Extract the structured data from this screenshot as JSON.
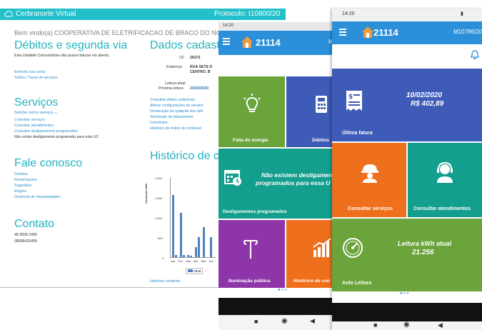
{
  "desktop": {
    "brand": "Cerbranorte Virtual",
    "protocol": "Protocolo: I10800/20",
    "protocol_tag": "(Sair)",
    "welcome": "Bem vindo(a) COOPERATIVA DE ELETRIFICACAO DE BRACO DO NORTE",
    "debitos_title": "Débitos e segunda via",
    "debitos_text": "Esta Unidade Consumidora não possui faturas em aberto.",
    "debitos_links": [
      "Entenda sua conta",
      "Tarifas / Taxas de serviços"
    ],
    "servicos_title": "Serviços",
    "servicos_links": [
      "Solicitar outros serviços",
      "Consultar serviços",
      "Consultar atendimentos",
      "Consultar desligamentos programados"
    ],
    "servicos_text": "Não existe desligamento programado para esta UC",
    "fale_title": "Fale conosco",
    "fale_links": [
      "Dúvidas",
      "Reclamações",
      "Sugestões",
      "Elogios",
      "Denúncia de irregularidades"
    ],
    "contato_title": "Contato",
    "contato_lines": [
      "48 3658 2499",
      "08006432499"
    ],
    "dados_title": "Dados cadastrais",
    "uc_label": "UC",
    "uc_value": "26272",
    "endereco_label": "Endereço",
    "endereco_value1": "RUA SETE D",
    "endereco_value2": "CENTRO, B",
    "leitura_label": "Leitura atual",
    "proxima_label": "Próxima leitura",
    "proxima_value": "20/02/2020",
    "dados_links": [
      "Consultar dados cadastrais",
      "Alterar configurações do usuário",
      "Declaração de quitação dos déb",
      "Simulação de faturamento",
      "Convênios",
      "Histórico de índice de continuid"
    ],
    "historico_title": "Histórico de con",
    "historico_link": "Histórico completo"
  },
  "chart_data": {
    "type": "bar",
    "title": "",
    "xlabel": "",
    "ylabel": "Consumo kWh",
    "categories": [
      "Jan",
      "Fev",
      "Mar",
      "Abr",
      "Mai",
      "Jun"
    ],
    "yticks": [
      "2,000",
      "1,500",
      "1,000",
      "500",
      "0"
    ],
    "ylim": [
      0,
      2000
    ],
    "series": [
      {
        "name": "2019",
        "color": "#4f81bd",
        "values": [
          1550,
          1100,
          50,
          250,
          750,
          500
        ]
      },
      {
        "name": "",
        "color": "#4f81bd",
        "values": [
          50,
          50,
          30,
          500,
          0,
          0
        ]
      }
    ],
    "legend": [
      "2019"
    ]
  },
  "phone1": {
    "time": "14:20",
    "uc": "21114",
    "protocol_partial": "M",
    "tiles": {
      "falta": "Falta de energia",
      "debitos": "Débitos",
      "deslig_caption": "Desligamentos programados",
      "deslig_msg1": "Não existem desligamen",
      "deslig_msg2": "programados para essa U",
      "iluminacao": "Iluminação pública",
      "historico": "Histórico de con"
    },
    "colors": {
      "green": "#6aa43b",
      "blue": "#3e5bb8",
      "teal": "#139e8e",
      "purple": "#8e35a9",
      "orange": "#ee6f1c"
    }
  },
  "phone2": {
    "time": "14:20",
    "uc": "21114",
    "protocol": "M10796/20",
    "fatura_date": "10/02/2020",
    "fatura_value": "R$ 402,89",
    "fatura_caption": "Última fatura",
    "servicos_caption": "Consultar serviços",
    "atendimentos_caption": "Consultar atendimentos",
    "leitura_title": "Leitura kWh atual",
    "leitura_value": "21.256",
    "leitura_caption": "Auto Leitura"
  }
}
